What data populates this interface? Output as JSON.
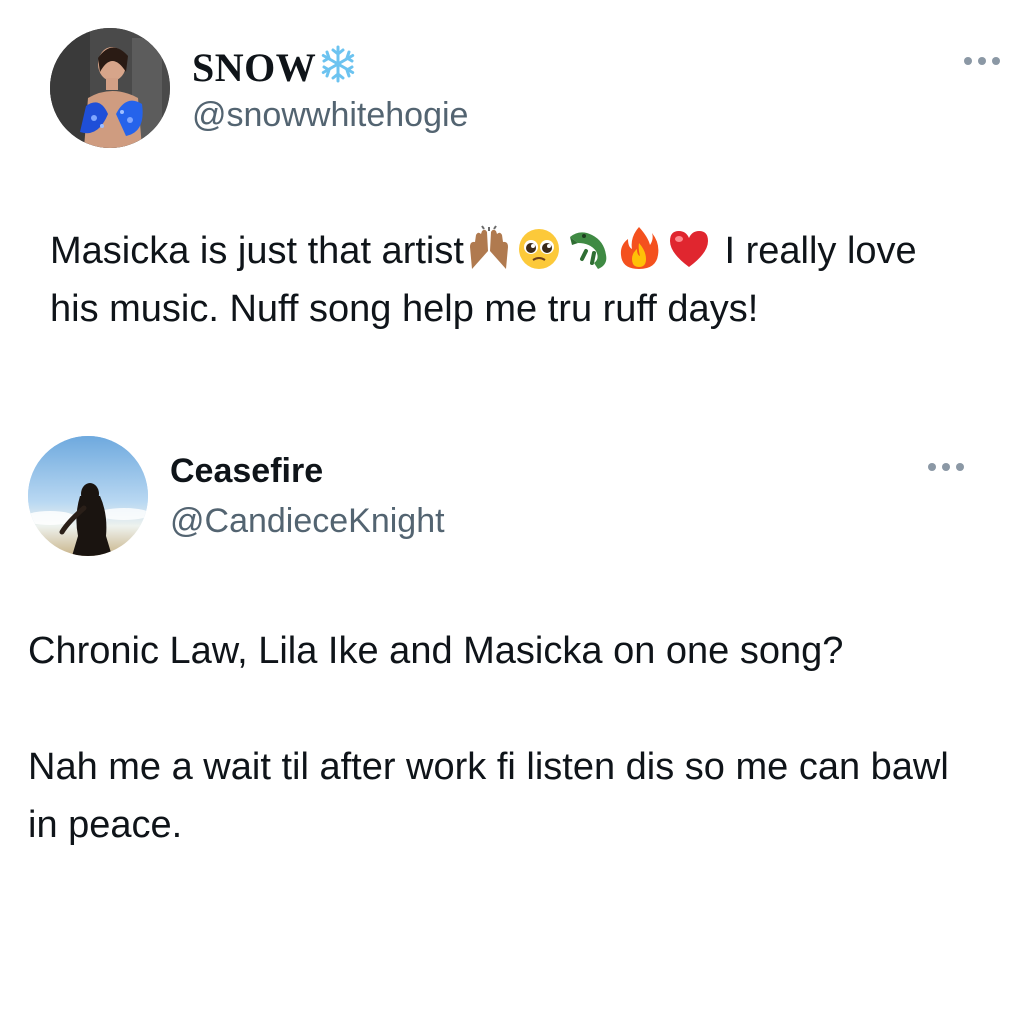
{
  "tweets": [
    {
      "display_name": "SNOW",
      "name_emoji": "snowflake-icon",
      "handle": "@snowwhitehogie",
      "text_before_emojis": "Masicka is just that artist",
      "emojis": [
        "raising-hands-icon",
        "pleading-face-icon",
        "crocodile-icon",
        "fire-icon",
        "red-heart-icon"
      ],
      "text_after_emojis": " I really love his music. Nuff song help me tru ruff days!"
    },
    {
      "display_name": "Ceasefire",
      "handle": "@CandieceKnight",
      "paragraphs": [
        "Chronic Law, Lila Ike and Masicka on one song?",
        "Nah me a wait til after work fi listen dis so me can bawl in peace."
      ]
    }
  ],
  "colors": {
    "text": "#0f1419",
    "secondary": "#536471",
    "background": "#ffffff"
  }
}
